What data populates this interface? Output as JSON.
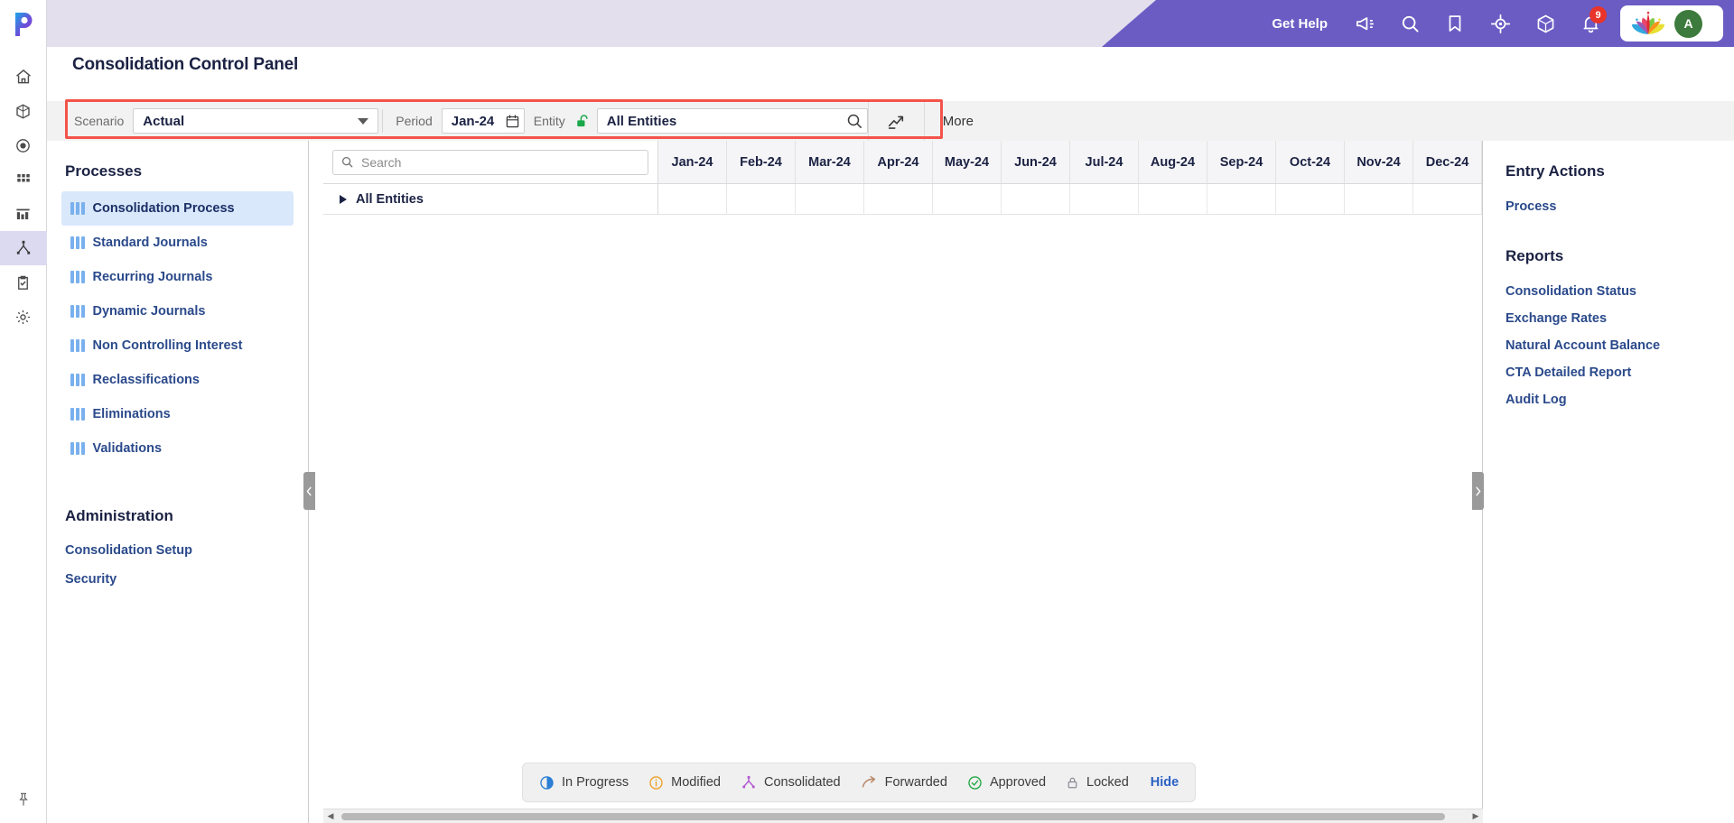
{
  "header": {
    "get_help": "Get Help",
    "icons": [
      {
        "name": "announcement-icon"
      },
      {
        "name": "search-icon"
      },
      {
        "name": "bookmark-icon"
      },
      {
        "name": "target-icon"
      },
      {
        "name": "cube-icon"
      },
      {
        "name": "notification-bell-icon"
      }
    ],
    "notification_count": "9",
    "avatar_initial": "A",
    "brand_purple": "#6b5cc4",
    "brand_bar": "#e3dfed"
  },
  "page": {
    "title": "Consolidation Control Panel"
  },
  "filters": {
    "scenario_label": "Scenario",
    "scenario_value": "Actual",
    "period_label": "Period",
    "period_value": "Jan-24",
    "entity_label": "Entity",
    "entity_value": "All Entities",
    "entity_lock_state": "unlocked",
    "chart_action": "",
    "more_label": "More",
    "highlight_color": "#f4534a"
  },
  "rail": {
    "logo": "p-logo-icon",
    "items": [
      {
        "name": "home-icon",
        "active": false
      },
      {
        "name": "cube-icon",
        "active": false
      },
      {
        "name": "record-circle-icon",
        "active": false
      },
      {
        "name": "grid-icon",
        "active": false
      },
      {
        "name": "bar-chart-icon",
        "active": false
      },
      {
        "name": "hierarchy-icon",
        "active": true
      },
      {
        "name": "clipboard-check-icon",
        "active": false
      },
      {
        "name": "gear-icon",
        "active": false
      }
    ],
    "pin": "pin-icon"
  },
  "processes": {
    "heading": "Processes",
    "items": [
      {
        "label": "Consolidation Process",
        "active": true
      },
      {
        "label": "Standard Journals",
        "active": false
      },
      {
        "label": "Recurring Journals",
        "active": false
      },
      {
        "label": "Dynamic Journals",
        "active": false
      },
      {
        "label": "Non Controlling Interest",
        "active": false
      },
      {
        "label": "Reclassifications",
        "active": false
      },
      {
        "label": "Eliminations",
        "active": false
      },
      {
        "label": "Validations",
        "active": false
      }
    ]
  },
  "administration": {
    "heading": "Administration",
    "items": [
      {
        "label": "Consolidation Setup"
      },
      {
        "label": "Security"
      }
    ]
  },
  "grid": {
    "search_placeholder": "Search",
    "search_value": "",
    "columns": [
      "Jan-24",
      "Feb-24",
      "Mar-24",
      "Apr-24",
      "May-24",
      "Jun-24",
      "Jul-24",
      "Aug-24",
      "Sep-24",
      "Oct-24",
      "Nov-24",
      "Dec-24"
    ],
    "rows": [
      {
        "label": "All Entities",
        "expanded": false
      }
    ]
  },
  "right_panel": {
    "entry_actions_heading": "Entry Actions",
    "entry_actions": [
      {
        "label": "Process"
      }
    ],
    "reports_heading": "Reports",
    "reports": [
      {
        "label": "Consolidation Status"
      },
      {
        "label": "Exchange Rates"
      },
      {
        "label": "Natural Account Balance"
      },
      {
        "label": "CTA Detailed Report"
      },
      {
        "label": "Audit Log"
      }
    ]
  },
  "legend": {
    "items": [
      {
        "label": "In Progress",
        "icon": "pie-progress-icon",
        "color": "#2b7fd4"
      },
      {
        "label": "Modified",
        "icon": "info-circle-icon",
        "color": "#eda028"
      },
      {
        "label": "Consolidated",
        "icon": "hierarchy-icon",
        "color": "#b055d0"
      },
      {
        "label": "Forwarded",
        "icon": "forward-arrow-icon",
        "color": "#b98a6a"
      },
      {
        "label": "Approved",
        "icon": "check-circle-icon",
        "color": "#22a845"
      },
      {
        "label": "Locked",
        "icon": "lock-icon",
        "color": "#8a8a96"
      }
    ],
    "hide_label": "Hide"
  }
}
